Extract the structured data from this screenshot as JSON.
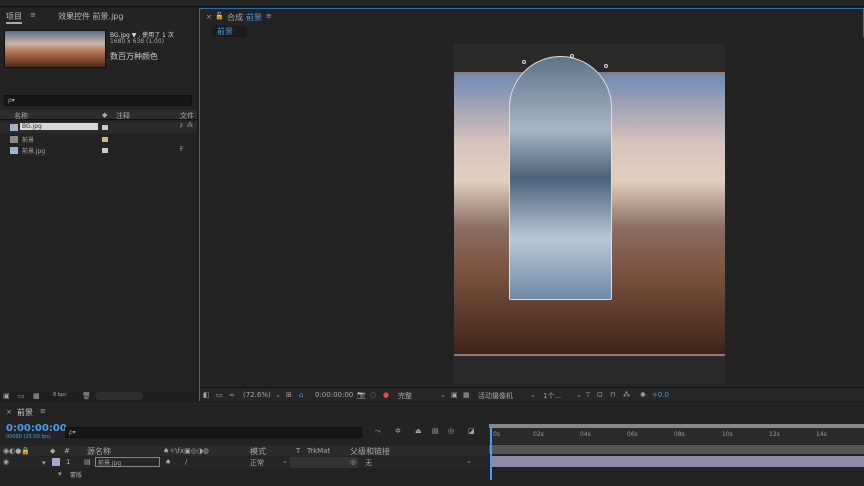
{
  "project_panel": {
    "tab_project": "项目",
    "tab_effects": "效果控件 前景.jpg",
    "footage_name": "BG.jpg ▼ , 使用了 1 次",
    "footage_size": "1680 x 638 (1.00)",
    "footage_colors": "数百万种颜色",
    "search_placeholder": "ρ▾",
    "col_name": "名称",
    "col_comment": "注释",
    "col_file": "文件",
    "items": [
      {
        "name": "BG.jpg",
        "color": "#c8c8d8",
        "extra": "F"
      },
      {
        "name": "前景",
        "color": "#c8b890",
        "extra": ""
      },
      {
        "name": "前景.jpg",
        "color": "#c8c8d8",
        "extra": "F"
      }
    ],
    "bpc": "8 bpc"
  },
  "comp_panel": {
    "title_prefix": "合成",
    "title": "前景",
    "breadcrumb": "前景"
  },
  "viewer_bar": {
    "zoom": "(72.6%)",
    "timecode": "0:00:00:00",
    "resolution": "完整",
    "camera": "活动摄像机",
    "views": "1个...",
    "exposure": "+0.0"
  },
  "timeline": {
    "tab": "前景",
    "timecode": "0:00:00:00",
    "frame_info": "00000 (25.00 fps)",
    "search_placeholder": "ρ▾",
    "col_layer_name": "源名称",
    "col_mode": "模式",
    "col_trkmat": "TrkMat",
    "col_parent": "父级和链接",
    "layer": {
      "index": "1",
      "name": "前景.jpg",
      "mode": "正常",
      "parent": "无"
    },
    "sub_row": "蒙版",
    "ruler": [
      "0s",
      "02s",
      "04s",
      "06s",
      "08s",
      "10s",
      "12s",
      "14s"
    ]
  },
  "colors": {
    "accent": "#4a9ee8",
    "panel": "#232323"
  }
}
